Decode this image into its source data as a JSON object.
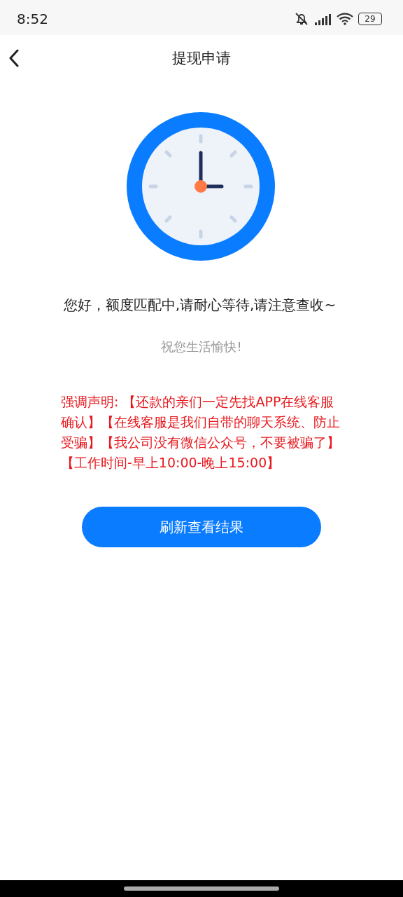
{
  "status_bar": {
    "time": "8:52",
    "battery": "29"
  },
  "nav": {
    "title": "提现申请"
  },
  "message": "您好，额度匹配中,请耐心等待,请注意查收~",
  "subtitle": "祝您生活愉快!",
  "notice": "强调声明: 【还款的亲们一定先找APP在线客服确认】【在线客服是我们自带的聊天系统、防止受骗】【我公司没有微信公众号，不要被骗了】【工作时间-早上10:00-晚上15:00】",
  "button": "刷新查看结果"
}
